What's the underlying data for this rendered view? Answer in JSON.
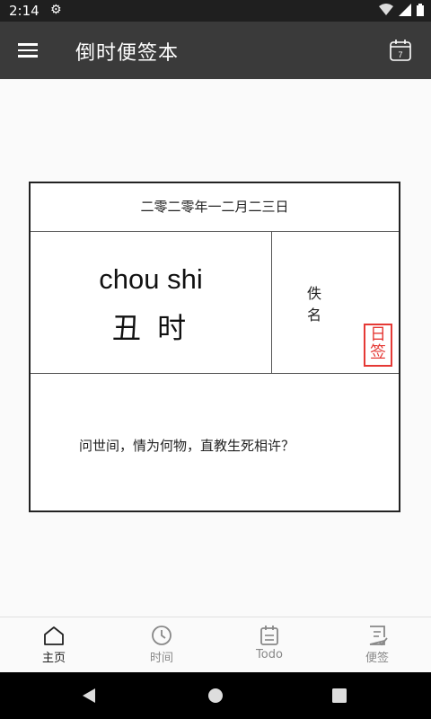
{
  "status": {
    "time": "2:14"
  },
  "app": {
    "title": "倒时便签本",
    "calendar_day": "7"
  },
  "card": {
    "date": "二零二零年一二月二三日",
    "pinyin": "chou shi",
    "hanzi": "丑 时",
    "author": "佚名",
    "seal": "日签",
    "quote": "问世间，情为何物，直教生死相许？"
  },
  "nav": [
    {
      "label": "主页",
      "icon": "home-icon",
      "active": true
    },
    {
      "label": "时间",
      "icon": "clock-icon",
      "active": false
    },
    {
      "label": "Todo",
      "icon": "todo-icon",
      "active": false
    },
    {
      "label": "便签",
      "icon": "note-icon",
      "active": false
    }
  ],
  "colors": {
    "appbar": "#3a3a3a",
    "seal": "#e53935"
  }
}
